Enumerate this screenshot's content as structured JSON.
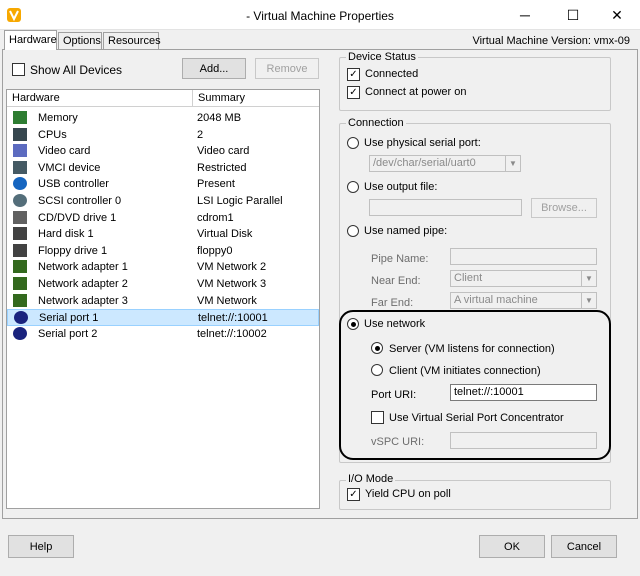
{
  "window": {
    "title": "- Virtual Machine Properties",
    "minimize_glyph": "─",
    "maximize_glyph": "☐",
    "close_glyph": "✕",
    "icon": "vsphere-icon",
    "accent_color": "#8dc63f"
  },
  "tabs": [
    {
      "label": "Hardware",
      "active": true
    },
    {
      "label": "Options",
      "active": false
    },
    {
      "label": "Resources",
      "active": false
    }
  ],
  "vm_version": "Virtual Machine Version: vmx-09",
  "hardware_panel": {
    "show_all_label": "Show All Devices",
    "show_all_checked": false,
    "add_label": "Add...",
    "remove_label": "Remove",
    "columns": [
      "Hardware",
      "Summary"
    ],
    "rows": [
      {
        "name": "Memory",
        "summary": "2048 MB",
        "icon": "memory-icon",
        "selected": false
      },
      {
        "name": "CPUs",
        "summary": "2",
        "icon": "cpu-icon",
        "selected": false
      },
      {
        "name": "Video card",
        "summary": "Video card",
        "icon": "video-card-icon",
        "selected": false
      },
      {
        "name": "VMCI device",
        "summary": "Restricted",
        "icon": "vmci-icon",
        "selected": false
      },
      {
        "name": "USB controller",
        "summary": "Present",
        "icon": "usb-icon",
        "selected": false
      },
      {
        "name": "SCSI controller 0",
        "summary": "LSI Logic Parallel",
        "icon": "scsi-icon",
        "selected": false
      },
      {
        "name": "CD/DVD drive 1",
        "summary": "cdrom1",
        "icon": "cd-icon",
        "selected": false
      },
      {
        "name": "Hard disk 1",
        "summary": "Virtual Disk",
        "icon": "hard-disk-icon",
        "selected": false
      },
      {
        "name": "Floppy drive 1",
        "summary": "floppy0",
        "icon": "floppy-icon",
        "selected": false
      },
      {
        "name": "Network adapter 1",
        "summary": "VM Network 2",
        "icon": "network-icon",
        "selected": false
      },
      {
        "name": "Network adapter 2",
        "summary": "VM Network 3",
        "icon": "network-icon",
        "selected": false
      },
      {
        "name": "Network adapter 3",
        "summary": "VM Network",
        "icon": "network-icon",
        "selected": false
      },
      {
        "name": "Serial port 1",
        "summary": "telnet://:10001",
        "icon": "serial-port-icon",
        "selected": true
      },
      {
        "name": "Serial port 2",
        "summary": "telnet://:10002",
        "icon": "serial-port-icon",
        "selected": false
      }
    ]
  },
  "device_status": {
    "legend": "Device Status",
    "connected_label": "Connected",
    "connected_checked": true,
    "power_on_label": "Connect at power on",
    "power_on_checked": true
  },
  "connection": {
    "legend": "Connection",
    "physical_label": "Use physical serial port:",
    "physical_value": "/dev/char/serial/uart0",
    "output_label": "Use output file:",
    "output_value": "",
    "browse_label": "Browse...",
    "pipe_label": "Use named pipe:",
    "pipe_name_label": "Pipe Name:",
    "pipe_name_value": "",
    "near_end_label": "Near End:",
    "near_end_value": "Client",
    "far_end_label": "Far End:",
    "far_end_value": "A virtual machine",
    "network_label": "Use network",
    "server_label": "Server  (VM listens for connection)",
    "client_label": "Client  (VM initiates connection)",
    "port_uri_label": "Port URI:",
    "port_uri_value": "telnet://:10001",
    "vspc_check_label": "Use Virtual Serial Port Concentrator",
    "vspc_checked": false,
    "vspc_uri_label": "vSPC URI:",
    "vspc_uri_value": ""
  },
  "io_mode": {
    "legend": "I/O Mode",
    "yield_label": "Yield CPU on poll",
    "yield_checked": true
  },
  "footer": {
    "help_label": "Help",
    "ok_label": "OK",
    "cancel_label": "Cancel"
  },
  "check_glyph": "✓",
  "dropdown_glyph": "▼"
}
